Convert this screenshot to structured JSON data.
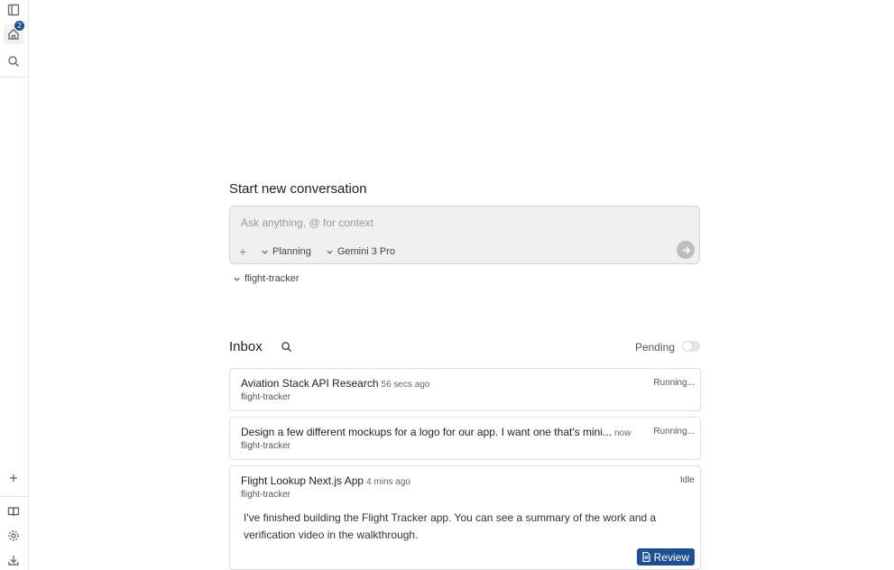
{
  "rail": {
    "inbox_badge": "2"
  },
  "composer": {
    "title": "Start new conversation",
    "placeholder": "Ask anything, @ for context",
    "mode": "Planning",
    "model": "Gemini 3 Pro",
    "workspace": "flight-tracker"
  },
  "inbox": {
    "title": "Inbox",
    "pending_label": "Pending",
    "pending_on": false,
    "items": [
      {
        "title": "Aviation Stack API Research",
        "time": "56 secs ago",
        "workspace": "flight-tracker",
        "status": "Running..."
      },
      {
        "title": "Design a few different mockups for a logo for our app. I want one that's mini...",
        "time": "now",
        "workspace": "flight-tracker",
        "status": "Running..."
      },
      {
        "title": "Flight Lookup Next.js App",
        "time": "4 mins ago",
        "workspace": "flight-tracker",
        "status": "Idle",
        "message": "I've finished building the Flight Tracker app. You can see a summary of the work and a verification video in the walkthrough.",
        "action": "Review"
      }
    ]
  },
  "colors": {
    "accent": "#1d4f91",
    "composer_bg": "#f0f0f1"
  }
}
